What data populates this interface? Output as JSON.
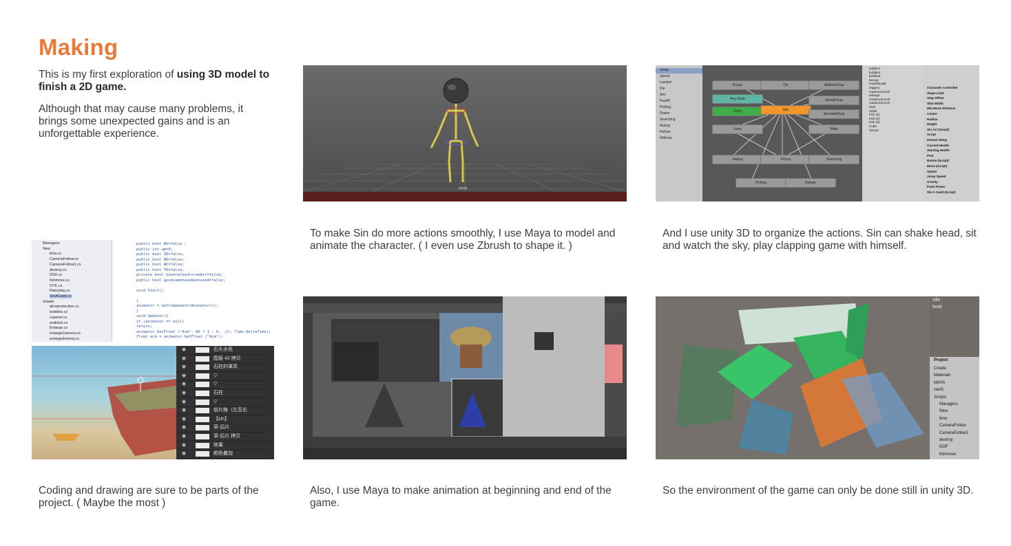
{
  "title": "Making",
  "intro": {
    "line1_prefix": "This is my first exploration of ",
    "line1_bold": "using 3D model to finish a 2D game.",
    "paragraph2": "Although that may cause many problems, it brings some unexpected gains and is an unforgettable experience."
  },
  "captions": {
    "maya_model": "To make Sin do more actions smoothly, I use Maya to model and animate the character. ( I even use Zbrush to shape it. )",
    "unity_actions": "And I use unity 3D to organize the actions. Sin can shake head, sit and watch the sky, play clapping game with himself.",
    "coding_drawing": "Coding and drawing are sure to be parts of the project. ( Maybe the most )",
    "maya_animation": "Also, I use Maya to make animation at beginning and end of the game.",
    "unity_environment": "So the environment of the game can only be done still in unity 3D."
  },
  "maya_view": {
    "frame_label": "persp"
  },
  "unity_animator": {
    "params": [
      "Jump",
      "Speed",
      "Landed",
      "Die",
      "Aim",
      "PushR",
      "Picking",
      "Drawn",
      "Searching",
      "Asking",
      "Refuse",
      "Withrop"
    ],
    "states": [
      "Drawn",
      "Die",
      "WalkwithSup",
      "Any State",
      "IdlewithSup",
      "Entry",
      "Idle",
      "StandwithSup",
      "Jump",
      "Walk",
      "Asking",
      "Pickup",
      "Searching",
      "Picking",
      "Refuse"
    ],
    "hierarchy": [
      "bubble1",
      "bubble2",
      "bubble3",
      "faceup",
      "invisiblewall",
      "trigger1",
      "mashroomColl",
      "enlarge",
      "mashroomColl",
      "mashroomColl",
      "stick",
      "rabbit",
      "trick (1)",
      "trick (2)",
      "trick (3)",
      "Cube",
      "Terrain"
    ],
    "inspector": [
      "Character Controller",
      "Slope Limit",
      "Step Offset",
      "Skin Width",
      "Min Move Distance",
      "Center",
      "Radius",
      "Height",
      "Sin AC (Script)",
      "Script",
      "Restart Delay",
      "Current Health",
      "Starting Health",
      "Pick",
      "Rotate (Script)",
      "Move (Script)",
      "Speed",
      "Jump Speed",
      "Gravity",
      "Push Power",
      "Sin A Cadd (Script)"
    ]
  },
  "code_shot": {
    "tree": [
      "Managers",
      "New",
      "bnw.cs",
      "CameraFollow.cs",
      "CameraFollow1.cs",
      "destroy.cs",
      "DOF.cs",
      "fishmove.cs",
      "OTE.cs",
      "Rainyday.cs",
      "SinACadd.cs",
      "shader",
      "aliceprotection.cs",
      "bubbles.cs",
      "cupend.cs",
      "endtrick.cs",
      "Enlarge.cs",
      "enlargeCamera.cs",
      "enlargedestroy.cs"
    ],
    "code": [
      "public bool WS=false ;",
      "public int wp=0;",
      "public bool SD=false;",
      "public bool RD=false;",
      "public bool WC=false;",
      "public bool TD=false;",
      "private bool havetalkedtorabbit=false;",
      "public bool goodcamehavebeenused=false;",
      "",
      "void Start()",
      "",
      "{",
      "  animator = GetComponent<Animator>();",
      "}",
      "void Update(){",
      "  if (animator == null)",
      "     return;",
      "  animator.SetFloat (\"Aim\", WS ? 1 : 0, .1f, Time.deltaTime);",
      "  float aim = animator.GetFloat (\"Aim\");"
    ]
  },
  "draw_shot": {
    "layers": [
      "石头水色",
      "图层 42 拷贝",
      "石柱的罩高",
      "▽",
      "▽",
      "石柱",
      "▽",
      "前片鎵（左至右",
      "【sin】",
      "草-后片",
      "草-后片 拷贝",
      "效果",
      "颜色叠加"
    ]
  },
  "unity_env": {
    "scene_labels": [
      "Idle",
      "boat"
    ],
    "project_title": "Project",
    "project_items": [
      "Create",
      "Materials",
      "MAYA",
      "rainS",
      "Scripts",
      "Managers",
      "New",
      "bnw",
      "CameraFollow",
      "CameraFollow1",
      "destroy",
      "DOF",
      "fishmove"
    ]
  }
}
